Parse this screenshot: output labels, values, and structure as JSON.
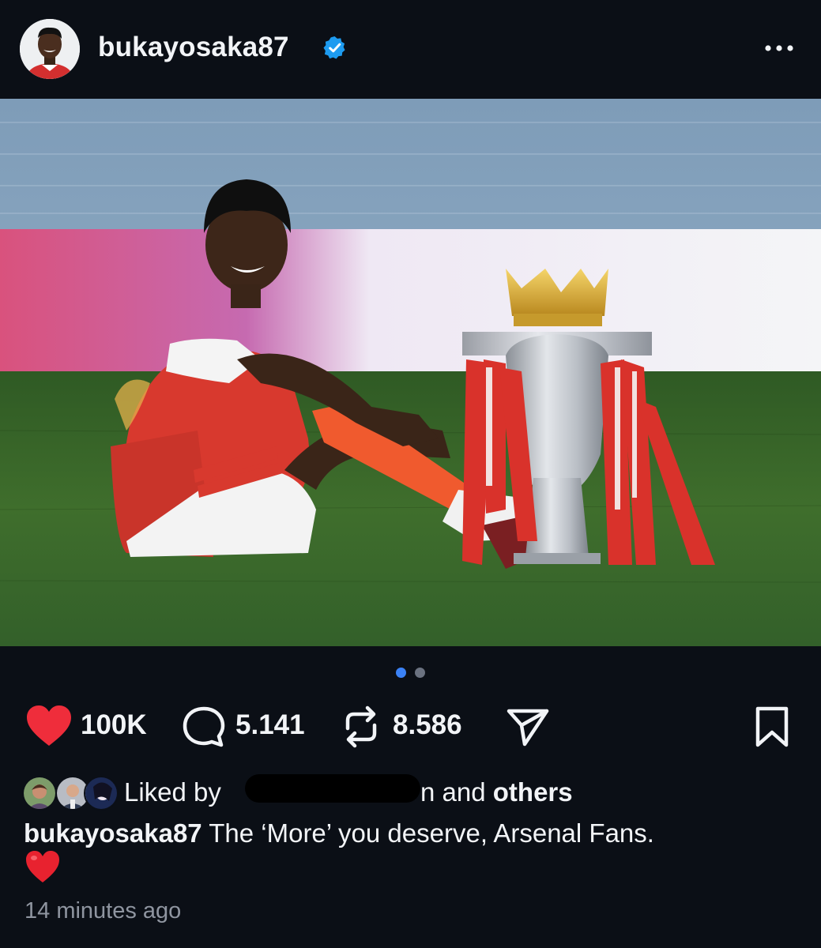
{
  "post": {
    "username": "bukayosaka87",
    "verified_icon": "verified-badge-icon",
    "more_icon": "more-options-icon",
    "carousel": {
      "total": 2,
      "active": 1,
      "active_color": "#3b82f6",
      "inactive_color": "#6b7280"
    }
  },
  "actions": {
    "likes_count": "100K",
    "comments_count": "5.141",
    "reposts_count": "8.586",
    "like_icon": "heart-icon",
    "comment_icon": "comment-bubble-icon",
    "repost_icon": "repost-icon",
    "share_icon": "send-icon",
    "save_icon": "bookmark-icon",
    "heart_color": "#ef2d3b"
  },
  "liked_by": {
    "prefix": "Liked by",
    "redacted_suffix": "n",
    "and_text": "and",
    "others_text": "others"
  },
  "caption": {
    "username": "bukayosaka87",
    "text": "The ‘More’ you deserve, Arsenal Fans.",
    "emoji": "❤️"
  },
  "timestamp": "14 minutes ago"
}
